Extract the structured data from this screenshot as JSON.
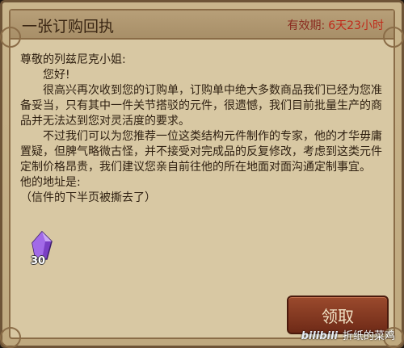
{
  "window": {
    "title": "一张订购回执",
    "validity_label": "有效期:",
    "validity_value": "6天23小时"
  },
  "letter": {
    "salutation": "尊敬的列兹尼克小姐:",
    "greeting": "您好!",
    "paragraph_1": "很高兴再次收到您的订购单，订购单中绝大多数商品我们已经为您准备妥当，只有其中一件关节搭驳的元件，很遗憾，我们目前批量生产的商品并无法达到您对灵活度的要求。",
    "paragraph_2": "不过我们可以为您推荐一位这类结构元件制作的专家，他的才华毋庸置疑，但脾气略微古怪，并不接受对完成品的反复修改，考虑到这类元件定制价格昂贵，我们建议您亲自前往他的所在地面对面沟通定制事宜。",
    "address_label": "他的地址是:",
    "note": "（信件的下半页被撕去了）"
  },
  "reward": {
    "icon": "purple-crystal-icon",
    "count": "30",
    "color": "#8a4fd6"
  },
  "actions": {
    "claim_label": "领取"
  },
  "watermark": {
    "logo": "bilibili",
    "text": "折纸的菜鸡"
  }
}
